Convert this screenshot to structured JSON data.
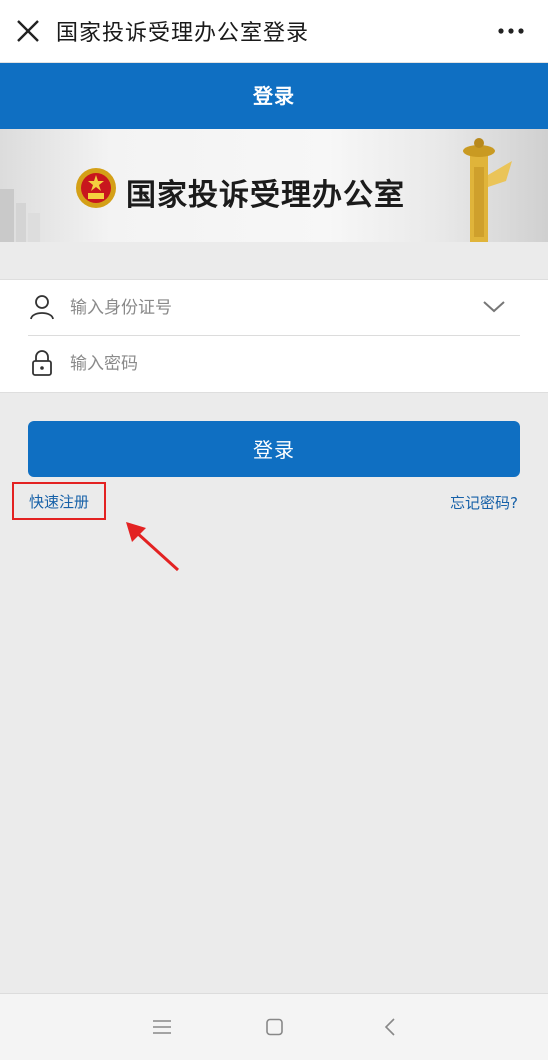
{
  "topbar": {
    "title": "国家投诉受理办公室登录",
    "close_icon": "close-icon",
    "more_icon": "more-dots-icon"
  },
  "header": {
    "title": "登录"
  },
  "banner": {
    "title": "国家投诉受理办公室",
    "emblem_icon": "national-emblem-icon",
    "pillar_icon": "huabiao-pillar-icon"
  },
  "form": {
    "id_placeholder": "输入身份证号",
    "password_placeholder": "输入密码",
    "id_icon": "user-icon",
    "password_icon": "lock-icon",
    "dropdown_icon": "chevron-down-icon"
  },
  "actions": {
    "login_label": "登录",
    "register_label": "快速注册",
    "forgot_label": "忘记密码?"
  },
  "colors": {
    "primary": "#0f6fc2",
    "link": "#1761a8",
    "highlight": "#e32222",
    "background": "#ebebeb"
  },
  "navbar": {
    "menu_icon": "menu-icon",
    "home_icon": "home-square-icon",
    "back_icon": "back-icon"
  }
}
